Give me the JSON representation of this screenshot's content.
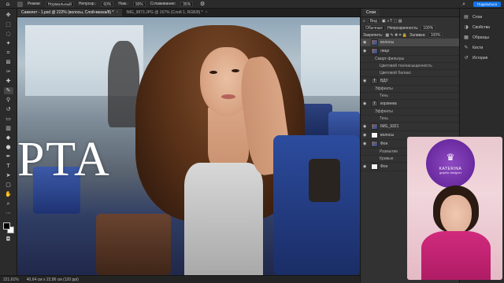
{
  "options_bar": {
    "mode_label": "Режим:",
    "mode_value": "Нормальный",
    "opacity_label": "Непрозр.:",
    "opacity_value": "60%",
    "pressure_label": "Наж.:",
    "pressure_value": "90%",
    "smoothing_label": "Сглаживание:",
    "smoothing_value": "35%",
    "share_label": "Поделиться"
  },
  "tabs": [
    {
      "label": "Самолет - 1.psd @ 222% (волосы, Слой-маска/8) *"
    },
    {
      "label": "IMG_9873.JPG @ 167% (Слой 1, RGB/8) *"
    }
  ],
  "toolbar": {
    "tools": [
      "move",
      "marquee",
      "lasso",
      "wand",
      "crop",
      "frame",
      "eyedropper",
      "heal",
      "brush",
      "stamp",
      "history",
      "eraser",
      "gradient",
      "blur",
      "dodge",
      "pen",
      "type",
      "path",
      "shape",
      "hand",
      "zoom"
    ]
  },
  "canvas": {
    "overlay_text": "РТА"
  },
  "statusbar": {
    "zoom": "221,61%",
    "dimensions": "40,64 см x 22,86 см (120 ppi)"
  },
  "layers_panel": {
    "tab": "Слои",
    "kind_label": "Вид",
    "blend_mode": "Обычные",
    "opacity_label": "Непрозрачность:",
    "opacity_value": "100%",
    "lock_label": "Закрепить:",
    "fill_label": "Заливка:",
    "fill_value": "100%",
    "layers": [
      {
        "name": "волосы",
        "kind": "layer",
        "thumb": "photo",
        "selected": true
      },
      {
        "name": "лицо",
        "kind": "layer",
        "thumb": "photo"
      },
      {
        "name": "Смарт-фильтры",
        "kind": "sub"
      },
      {
        "name": "Цветовой тон/насыщенность",
        "kind": "sub2"
      },
      {
        "name": "Цветовой баланс",
        "kind": "sub2"
      },
      {
        "name": "ВДУ",
        "kind": "layer",
        "thumb": "text"
      },
      {
        "name": "Эффекты",
        "kind": "sub"
      },
      {
        "name": "Тень",
        "kind": "sub2"
      },
      {
        "name": "корзинка",
        "kind": "layer",
        "thumb": "text"
      },
      {
        "name": "Эффекты",
        "kind": "sub"
      },
      {
        "name": "Тень",
        "kind": "sub2"
      },
      {
        "name": "IMG_9321",
        "kind": "layer",
        "thumb": "photo"
      },
      {
        "name": "волосы",
        "kind": "layer",
        "thumb": "white"
      },
      {
        "name": "Фон",
        "kind": "layer",
        "thumb": "photo"
      },
      {
        "name": "Размытие",
        "kind": "sub2"
      },
      {
        "name": "Кривые",
        "kind": "sub2"
      },
      {
        "name": "Фон",
        "kind": "layer",
        "thumb": "white"
      }
    ]
  },
  "side_panel": {
    "items": [
      {
        "icon": "▤",
        "label": "Слои"
      },
      {
        "icon": "◑",
        "label": "Свойства"
      },
      {
        "icon": "▦",
        "label": "Образцы"
      },
      {
        "icon": "✎",
        "label": "Кисти"
      },
      {
        "icon": "↺",
        "label": "История"
      }
    ]
  },
  "webcam": {
    "logo_name": "KATERINA",
    "logo_sub": "graphic designer"
  }
}
